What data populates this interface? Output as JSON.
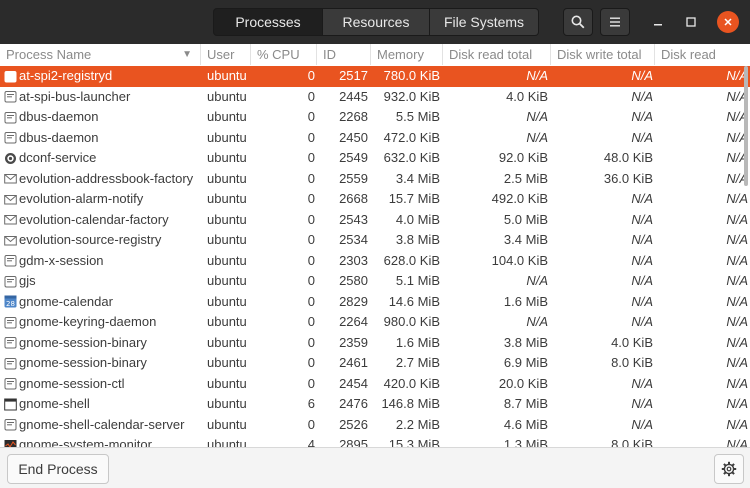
{
  "header": {
    "tabs": [
      {
        "label": "Processes",
        "active": true
      },
      {
        "label": "Resources",
        "active": false
      },
      {
        "label": "File Systems",
        "active": false
      }
    ],
    "icons": [
      "search-icon",
      "menu-icon",
      "minimize-icon",
      "maximize-icon",
      "close-icon"
    ]
  },
  "table": {
    "columns": [
      "Process Name",
      "User",
      "% CPU",
      "ID",
      "Memory",
      "Disk read total",
      "Disk write total",
      "Disk read"
    ],
    "rows": [
      {
        "name": "at-spi2-registryd",
        "user": "ubuntu",
        "cpu": "0",
        "id": "2517",
        "memory": "780.0 KiB",
        "disk_read_total": "N/A",
        "disk_write_total": "N/A",
        "disk_read": "N/A",
        "icon": "generic-process-icon",
        "selected": true
      },
      {
        "name": "at-spi-bus-launcher",
        "user": "ubuntu",
        "cpu": "0",
        "id": "2445",
        "memory": "932.0 KiB",
        "disk_read_total": "4.0 KiB",
        "disk_write_total": "N/A",
        "disk_read": "N/A",
        "icon": "generic-process-icon"
      },
      {
        "name": "dbus-daemon",
        "user": "ubuntu",
        "cpu": "0",
        "id": "2268",
        "memory": "5.5 MiB",
        "disk_read_total": "N/A",
        "disk_write_total": "N/A",
        "disk_read": "N/A",
        "icon": "generic-process-icon"
      },
      {
        "name": "dbus-daemon",
        "user": "ubuntu",
        "cpu": "0",
        "id": "2450",
        "memory": "472.0 KiB",
        "disk_read_total": "N/A",
        "disk_write_total": "N/A",
        "disk_read": "N/A",
        "icon": "generic-process-icon"
      },
      {
        "name": "dconf-service",
        "user": "ubuntu",
        "cpu": "0",
        "id": "2549",
        "memory": "632.0 KiB",
        "disk_read_total": "92.0 KiB",
        "disk_write_total": "48.0 KiB",
        "disk_read": "N/A",
        "icon": "dconf-gear-icon"
      },
      {
        "name": "evolution-addressbook-factory",
        "user": "ubuntu",
        "cpu": "0",
        "id": "2559",
        "memory": "3.4 MiB",
        "disk_read_total": "2.5 MiB",
        "disk_write_total": "36.0 KiB",
        "disk_read": "N/A",
        "icon": "envelope-icon"
      },
      {
        "name": "evolution-alarm-notify",
        "user": "ubuntu",
        "cpu": "0",
        "id": "2668",
        "memory": "15.7 MiB",
        "disk_read_total": "492.0 KiB",
        "disk_write_total": "N/A",
        "disk_read": "N/A",
        "icon": "envelope-icon"
      },
      {
        "name": "evolution-calendar-factory",
        "user": "ubuntu",
        "cpu": "0",
        "id": "2543",
        "memory": "4.0 MiB",
        "disk_read_total": "5.0 MiB",
        "disk_write_total": "N/A",
        "disk_read": "N/A",
        "icon": "envelope-icon"
      },
      {
        "name": "evolution-source-registry",
        "user": "ubuntu",
        "cpu": "0",
        "id": "2534",
        "memory": "3.8 MiB",
        "disk_read_total": "3.4 MiB",
        "disk_write_total": "N/A",
        "disk_read": "N/A",
        "icon": "envelope-icon"
      },
      {
        "name": "gdm-x-session",
        "user": "ubuntu",
        "cpu": "0",
        "id": "2303",
        "memory": "628.0 KiB",
        "disk_read_total": "104.0 KiB",
        "disk_write_total": "N/A",
        "disk_read": "N/A",
        "icon": "generic-process-icon"
      },
      {
        "name": "gjs",
        "user": "ubuntu",
        "cpu": "0",
        "id": "2580",
        "memory": "5.1 MiB",
        "disk_read_total": "N/A",
        "disk_write_total": "N/A",
        "disk_read": "N/A",
        "icon": "generic-process-icon"
      },
      {
        "name": "gnome-calendar",
        "user": "ubuntu",
        "cpu": "0",
        "id": "2829",
        "memory": "14.6 MiB",
        "disk_read_total": "1.6 MiB",
        "disk_write_total": "N/A",
        "disk_read": "N/A",
        "icon": "calendar-icon",
        "icon_text": "28"
      },
      {
        "name": "gnome-keyring-daemon",
        "user": "ubuntu",
        "cpu": "0",
        "id": "2264",
        "memory": "980.0 KiB",
        "disk_read_total": "N/A",
        "disk_write_total": "N/A",
        "disk_read": "N/A",
        "icon": "generic-process-icon"
      },
      {
        "name": "gnome-session-binary",
        "user": "ubuntu",
        "cpu": "0",
        "id": "2359",
        "memory": "1.6 MiB",
        "disk_read_total": "3.8 MiB",
        "disk_write_total": "4.0 KiB",
        "disk_read": "N/A",
        "icon": "generic-process-icon"
      },
      {
        "name": "gnome-session-binary",
        "user": "ubuntu",
        "cpu": "0",
        "id": "2461",
        "memory": "2.7 MiB",
        "disk_read_total": "6.9 MiB",
        "disk_write_total": "8.0 KiB",
        "disk_read": "N/A",
        "icon": "generic-process-icon"
      },
      {
        "name": "gnome-session-ctl",
        "user": "ubuntu",
        "cpu": "0",
        "id": "2454",
        "memory": "420.0 KiB",
        "disk_read_total": "20.0 KiB",
        "disk_write_total": "N/A",
        "disk_read": "N/A",
        "icon": "generic-process-icon"
      },
      {
        "name": "gnome-shell",
        "user": "ubuntu",
        "cpu": "6",
        "id": "2476",
        "memory": "146.8 MiB",
        "disk_read_total": "8.7 MiB",
        "disk_write_total": "N/A",
        "disk_read": "N/A",
        "icon": "window-icon"
      },
      {
        "name": "gnome-shell-calendar-server",
        "user": "ubuntu",
        "cpu": "0",
        "id": "2526",
        "memory": "2.2 MiB",
        "disk_read_total": "4.6 MiB",
        "disk_write_total": "N/A",
        "disk_read": "N/A",
        "icon": "generic-process-icon"
      },
      {
        "name": "gnome-system-monitor",
        "user": "ubuntu",
        "cpu": "4",
        "id": "2895",
        "memory": "15.3 MiB",
        "disk_read_total": "1.3 MiB",
        "disk_write_total": "8.0 KiB",
        "disk_read": "N/A",
        "icon": "monitor-icon"
      }
    ]
  },
  "footer": {
    "end_process_label": "End Process",
    "settings_icon": "gear-icon"
  },
  "colors": {
    "accent": "#e95420",
    "headerbar": "#2b2b2b"
  }
}
